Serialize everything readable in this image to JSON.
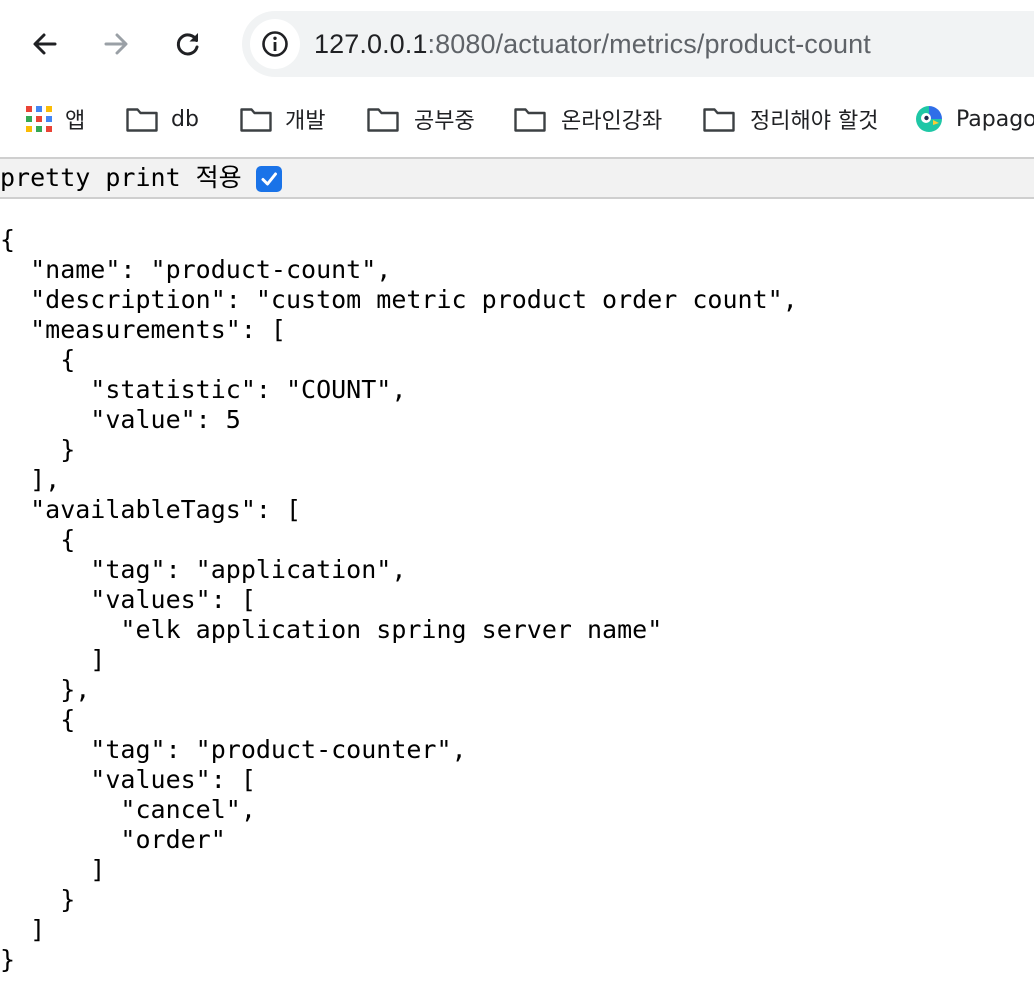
{
  "browser": {
    "url_host": "127.0.0.1",
    "url_rest": ":8080/actuator/metrics/product-count",
    "bookmarks": [
      {
        "label": "앱",
        "icon": "apps-grid-icon"
      },
      {
        "label": "db",
        "icon": "folder-icon"
      },
      {
        "label": "개발",
        "icon": "folder-icon"
      },
      {
        "label": "공부중",
        "icon": "folder-icon"
      },
      {
        "label": "온라인강좌",
        "icon": "folder-icon"
      },
      {
        "label": "정리해야 할것",
        "icon": "folder-icon"
      },
      {
        "label": "Papago",
        "icon": "papago-icon"
      }
    ]
  },
  "viewer": {
    "pretty_print_label": "pretty print 적용",
    "pretty_print_checked": true
  },
  "content": {
    "json_text": "{\n  \"name\": \"product-count\",\n  \"description\": \"custom metric product order count\",\n  \"measurements\": [\n    {\n      \"statistic\": \"COUNT\",\n      \"value\": 5\n    }\n  ],\n  \"availableTags\": [\n    {\n      \"tag\": \"application\",\n      \"values\": [\n        \"elk application spring server name\"\n      ]\n    },\n    {\n      \"tag\": \"product-counter\",\n      \"values\": [\n        \"cancel\",\n        \"order\"\n      ]\n    }\n  ]\n}"
  },
  "colors": {
    "accent": "#1a73e8",
    "toolbar_field": "#f1f3f4",
    "pretty_print_bar": "#f2f2f2"
  }
}
